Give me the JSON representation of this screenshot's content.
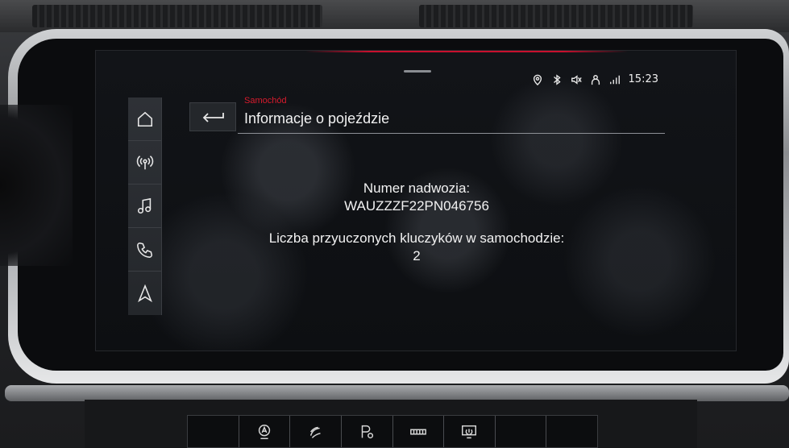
{
  "status_bar": {
    "time": "15:23",
    "icons": [
      "location-pin-icon",
      "bluetooth-icon",
      "mute-icon",
      "user-icon",
      "signal-icon"
    ]
  },
  "sidebar": {
    "items": [
      {
        "icon": "home-icon"
      },
      {
        "icon": "radio-icon"
      },
      {
        "icon": "music-icon"
      },
      {
        "icon": "phone-icon"
      },
      {
        "icon": "navigation-icon"
      }
    ]
  },
  "header": {
    "breadcrumb": "Samochód",
    "title": "Informacje o pojeździe"
  },
  "info": {
    "vin_label": "Numer nadwozia:",
    "vin_value": "WAUZZZF22PN046756",
    "keys_label": "Liczba przyuczonych kluczyków w samochodzie:",
    "keys_value": "2"
  },
  "console_buttons": [
    {
      "icon": "auto-off-icon"
    },
    {
      "icon": "drive-select-icon"
    },
    {
      "icon": "park-assist-icon"
    },
    {
      "icon": "hazard-panel-icon"
    },
    {
      "icon": "display-off-icon"
    }
  ],
  "colors": {
    "accent_red": "#d81b2d",
    "text": "#f2f2f2",
    "screen_bg": "#0d0f12"
  }
}
